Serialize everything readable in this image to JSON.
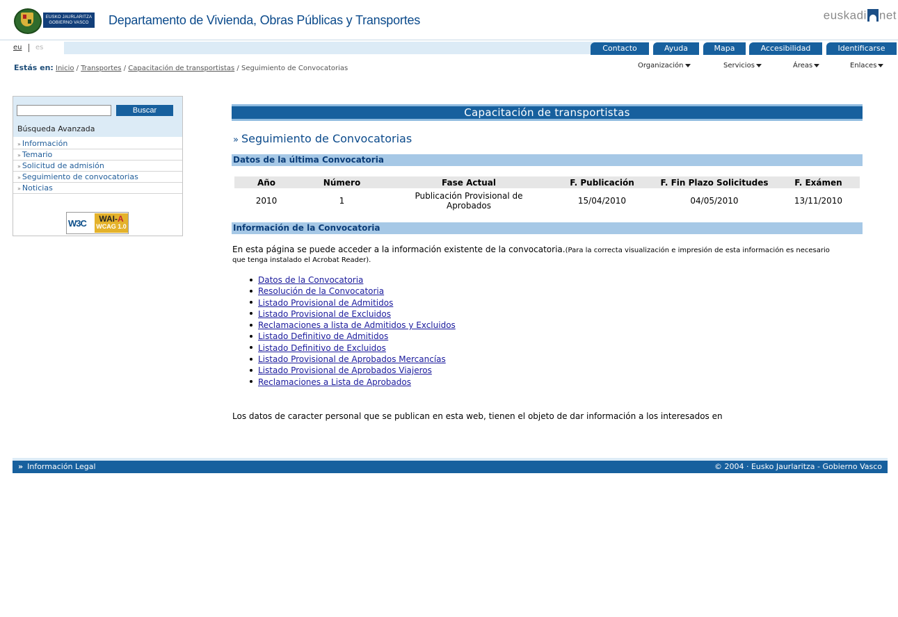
{
  "header": {
    "gov_line1": "EUSKO JAURLARITZA",
    "gov_line2": "GOBIERNO VASCO",
    "department_title": "Departamento de Vivienda, Obras Públicas y Transportes",
    "brand_left": "euskadi",
    "brand_right": "net"
  },
  "lang": {
    "eu": "eu",
    "es": "es"
  },
  "top_tabs": [
    "Contacto",
    "Ayuda",
    "Mapa",
    "Accesibilidad",
    "Identificarse"
  ],
  "breadcrumb": {
    "label": "Estás en:",
    "items": [
      "Inicio",
      "Transportes",
      "Capacitación de transportistas"
    ],
    "sep": "/",
    "current": "Seguimiento de Convocatorias"
  },
  "secondary_menu": [
    "Organización",
    "Servicios",
    "Áreas",
    "Enlaces"
  ],
  "sidebar": {
    "search_placeholder": "",
    "search_button": "Buscar",
    "advanced_search": "Búsqueda Avanzada",
    "raquo": "»",
    "items": [
      "Información",
      "Temario",
      "Solicitud de admisión",
      "Seguimiento de convocatorias",
      "Noticias"
    ],
    "badge_w3c": "W3C",
    "badge_wai_prefix": "WAI-",
    "badge_wai_level": "A",
    "badge_wcag": "WCAG 1.0"
  },
  "main": {
    "section_title": "Capacitación de transportistas",
    "heading_mark": "»",
    "heading": "Seguimiento de Convocatorias",
    "datos_title": "Datos de la última Convocatoria",
    "table": {
      "headers": [
        "Año",
        "Número",
        "Fase Actual",
        "F. Publicación",
        "F. Fin Plazo Solicitudes",
        "F. Exámen"
      ],
      "row": [
        "2010",
        "1",
        "Publicación Provisional de Aprobados",
        "15/04/2010",
        "04/05/2010",
        "13/11/2010"
      ]
    },
    "info_title": "Información de la Convocatoria",
    "info_text": "En esta página se puede acceder a la información existente de la convocatoria.",
    "info_note": "(Para la correcta visualización e impresión de esta información es necesario que tenga instalado el Acrobat Reader).",
    "documents": [
      "Datos de la Convocatoria",
      "Resolución de la Convocatoria",
      "Listado Provisional de Admitidos",
      "Listado Provisional de Excluidos",
      "Reclamaciones a lista de Admitidos y Excluidos",
      "Listado Definitivo de Admitidos",
      "Listado Definitivo de Excluidos",
      "Listado Provisional de Aprobados Mercancías",
      "Listado Provisional de Aprobados Viajeros",
      "Reclamaciones a Lista de Aprobados"
    ],
    "privacy_text": "Los datos de caracter personal que se publican en esta web, tienen el objeto de dar información a los interesados en"
  },
  "footer": {
    "legal_mark": "»",
    "legal": "Información Legal",
    "copyright": "© 2004 · Eusko Jaurlaritza - Gobierno Vasco"
  },
  "colors": {
    "primary": "#17609e",
    "light": "#dcebf6",
    "subhead": "#a6c8e6",
    "title_text": "#0b4a8b"
  }
}
